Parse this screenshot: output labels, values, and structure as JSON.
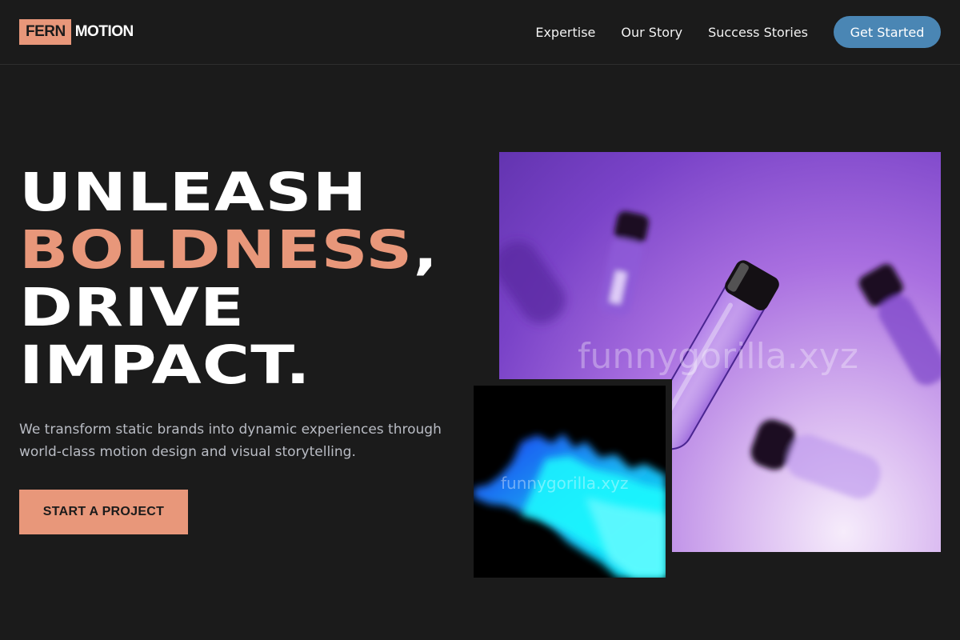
{
  "brand": {
    "logo_mark": "FERN",
    "logo_word": "MOTION",
    "accent_color": "#e8977a",
    "button_color": "#4a86b4"
  },
  "nav": {
    "links": [
      "Expertise",
      "Our Story",
      "Success Stories"
    ],
    "cta_label": "Get Started"
  },
  "hero": {
    "headline": {
      "line1": "UNLEASH",
      "line2_accent": "BOLDNESS",
      "line2_punct": ",",
      "line3": "DRIVE",
      "line4": "IMPACT."
    },
    "subtext": "We transform static brands into dynamic experiences through world-class motion design and visual storytelling.",
    "cta_label": "START A PROJECT"
  },
  "images": {
    "large": {
      "subject": "purple glass vials",
      "watermark": "funnygorilla.xyz"
    },
    "small": {
      "subject": "cyan light wave",
      "watermark": "funnygorilla.xyz"
    }
  }
}
